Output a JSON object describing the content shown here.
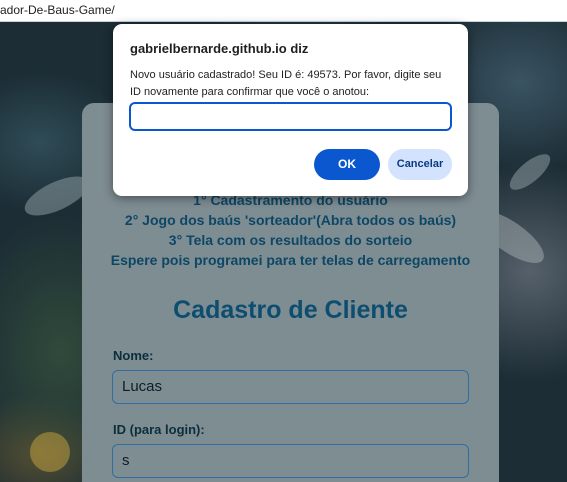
{
  "browser": {
    "url": "ador-De-Baus-Game/"
  },
  "page": {
    "steps": [
      "1° Cadastramento do usuário",
      "2° Jogo dos baús 'sorteador'(Abra todos os baús)",
      "3° Tela com os resultados do sorteio",
      "Espere pois programei para ter telas de carregamento"
    ],
    "form_title": "Cadastro de Cliente",
    "name_label": "Nome:",
    "name_value": "Lucas",
    "id_label": "ID (para login):",
    "id_value": "s"
  },
  "dialog": {
    "title": "gabrielbernarde.github.io diz",
    "message": "Novo usuário cadastrado! Seu ID é: 49573. Por favor, digite seu ID novamente para confirmar que você o anotou:",
    "input_value": "",
    "ok_label": "OK",
    "cancel_label": "Cancelar",
    "accent": "#0b57d0"
  }
}
